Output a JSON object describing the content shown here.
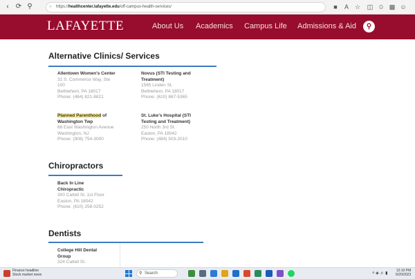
{
  "browser": {
    "url_prefix": "https://",
    "url_host": "healthcenter.lafayette.edu",
    "url_path": "/off-campus-health-services/"
  },
  "header": {
    "logo": "LAFAYETTE",
    "menu": [
      "About Us",
      "Academics",
      "Campus Life",
      "Admissions & Aid"
    ]
  },
  "sections": {
    "alternative": {
      "title": "Alternative Clinics/ Services",
      "clinics": [
        {
          "name": "Allentown Women's Center",
          "lines": [
            "31 S. Commerce Way, Ste",
            "100",
            "Bethlehem, PA 18017",
            "Phone: (484) 821-8821"
          ]
        },
        {
          "name": "Novus (STI Testing and",
          "name2": "Treatment)",
          "lines": [
            "1565 Linden St.",
            "Bethlehem, PA 18017",
            "Phone: (610) 867-5365"
          ]
        },
        {
          "name_highlight": "Planned Parenthood",
          "name_rest": " of",
          "name2": "Washington Twp",
          "lines": [
            "66 East Washington Avenue",
            "Washington, NJ",
            "Phone: (908) 754-3000"
          ]
        },
        {
          "name": "St. Luke's Hospital (STI",
          "name2": "Testing and Treatment)",
          "lines": [
            "250 North 3rd St.",
            "Easton, PA 18042",
            "Phone: (484) 503-2010"
          ]
        }
      ]
    },
    "chiropractors": {
      "title": "Chiropractors",
      "clinic": {
        "name": "Back In Line",
        "name2": "Chiropractic",
        "lines": [
          "300 Cattell St. 1st Floor",
          "Easton, PA 18042",
          "Phone: (610) 258-0252"
        ]
      }
    },
    "dentists": {
      "title": "Dentists",
      "clinic": {
        "name": "College Hill Dental",
        "name2": "Group",
        "lines": [
          "324 Cattell St."
        ]
      }
    }
  },
  "taskbar": {
    "news_title": "Finance headline",
    "news_sub": "Stock market news",
    "search_placeholder": "Search",
    "time": "12:10 PM",
    "date": "6/20/2023"
  },
  "colors": {
    "brand": "#980c2e",
    "accent_rule": "#3b7bbd",
    "highlight": "#fdee8a"
  }
}
